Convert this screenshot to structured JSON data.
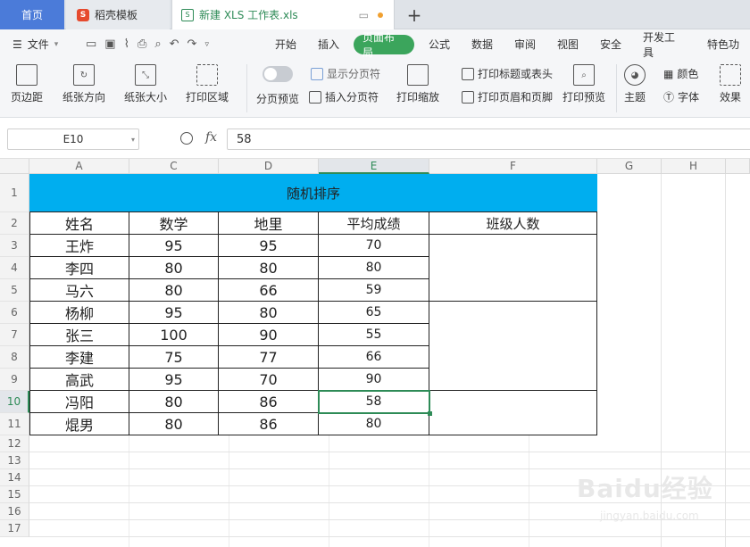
{
  "tabs": {
    "home": "首页",
    "daoke": "稻壳模板",
    "doc": "新建 XLS 工作表.xls",
    "add": "+"
  },
  "menu": {
    "file": "文件",
    "items": [
      "开始",
      "插入",
      "页面布局",
      "公式",
      "数据",
      "审阅",
      "视图",
      "安全",
      "开发工具",
      "特色功"
    ]
  },
  "ribbon": {
    "margin": "页边距",
    "orientation": "纸张方向",
    "size": "纸张大小",
    "print_area": "打印区域",
    "page_preview": "分页预览",
    "show_breaks": "显示分页符",
    "insert_break": "插入分页符",
    "print_scale": "打印缩放",
    "print_titles": "打印标题或表头",
    "print_header_footer": "打印页眉和页脚",
    "print_preview": "打印预览",
    "theme": "主题",
    "color": "颜色",
    "font": "字体",
    "effect": "效果"
  },
  "formula": {
    "name_box": "E10",
    "fx": "fx",
    "value": "58"
  },
  "columns": [
    "A",
    "C",
    "D",
    "E",
    "F",
    "G",
    "H"
  ],
  "rows": [
    "1",
    "2",
    "3",
    "4",
    "5",
    "6",
    "7",
    "8",
    "9",
    "10",
    "11",
    "12",
    "13",
    "14",
    "15",
    "16",
    "17"
  ],
  "table": {
    "title": "随机排序",
    "headers": [
      "姓名",
      "数学",
      "地里",
      "平均成绩",
      "班级人数"
    ],
    "data": [
      [
        "王炸",
        "95",
        "95",
        "70"
      ],
      [
        "李四",
        "80",
        "80",
        "80"
      ],
      [
        "马六",
        "80",
        "66",
        "59"
      ],
      [
        "杨柳",
        "95",
        "80",
        "65"
      ],
      [
        "张三",
        "100",
        "90",
        "55"
      ],
      [
        "李建",
        "75",
        "77",
        "66"
      ],
      [
        "高武",
        "95",
        "70",
        "90"
      ],
      [
        "冯阳",
        "80",
        "86",
        "58"
      ],
      [
        "焜男",
        "80",
        "86",
        "80"
      ]
    ]
  },
  "watermark": {
    "main": "Baidu经验",
    "sub": "jingyan.baidu.com"
  },
  "colors": {
    "accent": "#3ba55c",
    "title_fill": "#00aeef",
    "home_tab": "#4b7bd9"
  }
}
